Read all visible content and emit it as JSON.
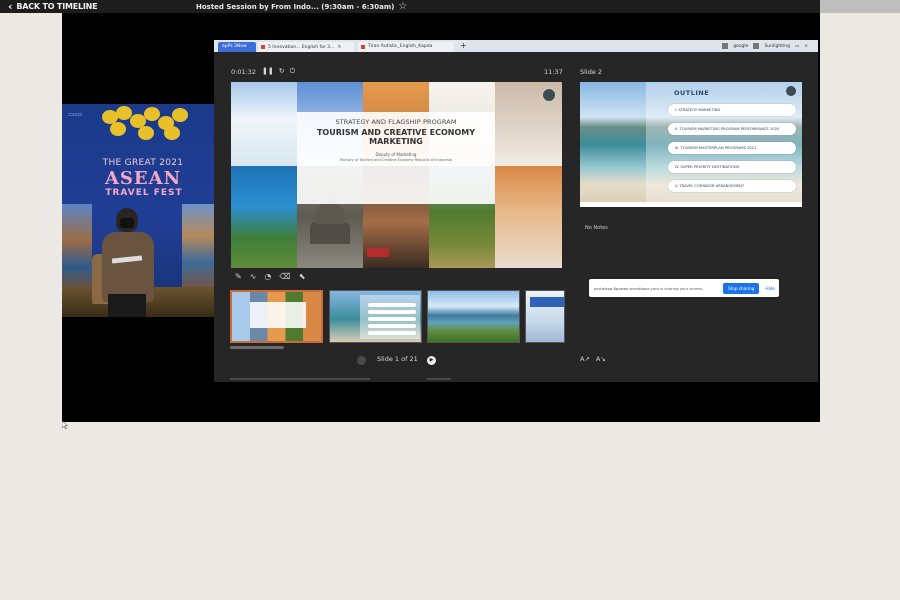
{
  "topbar": {
    "back_label": "BACK TO TIMELINE",
    "session_title": "Hosted Session by From Indo... (9:30am - 6:30am)"
  },
  "webcam": {
    "event_line1": "THE GREAT 2021",
    "event_line2": "ASEAN",
    "event_line3": "TRAVEL FEST"
  },
  "browser": {
    "tabs": [
      {
        "label": "apPs 3Now",
        "active": true
      },
      {
        "label": "5 Innovation...  English for 3...",
        "active": false
      },
      {
        "label": "Tiran Autistic_English_Kapda",
        "active": false
      }
    ],
    "account": "google",
    "account2": "Sunlighting"
  },
  "presenter": {
    "elapsed": "0:01:32",
    "clock": "11:37",
    "next_label": "Slide 2",
    "slide_counter": "Slide 1 of 21",
    "notes": "No Notes"
  },
  "current_slide": {
    "title_line1": "STRATEGY AND FLAGSHIP PROGRAM",
    "title_line2": "TOURISM AND CREATIVE ECONOMY MARKETING",
    "subtitle1": "Deputy of Marketing",
    "subtitle2": "Ministry of Tourism and Creative Economy Republic of Indonesia"
  },
  "next_slide": {
    "heading": "OUTLINE",
    "items": [
      "I. STRATEGY MARKETING",
      "II. TOURISM MARKETING PROGRAM PERFORMANCE 2020",
      "III. TOURISM MASTERPLAN PROGRAMS 2021",
      "IV. SUPER PRIORITY DESTINATIONS",
      "V. TRAVEL CORRIDOR ARRANGEMENT"
    ]
  },
  "sharebar": {
    "message": "portalapp.6gaweb.eventbase.com is sharing your screen.",
    "stop_label": "Stop sharing",
    "hide_label": "Hide"
  },
  "colors": {
    "accent_blue": "#1a73e8",
    "selected_thumb": "#c96b3a",
    "stage_bg": "#000000",
    "page_bg": "#ece9e5"
  }
}
